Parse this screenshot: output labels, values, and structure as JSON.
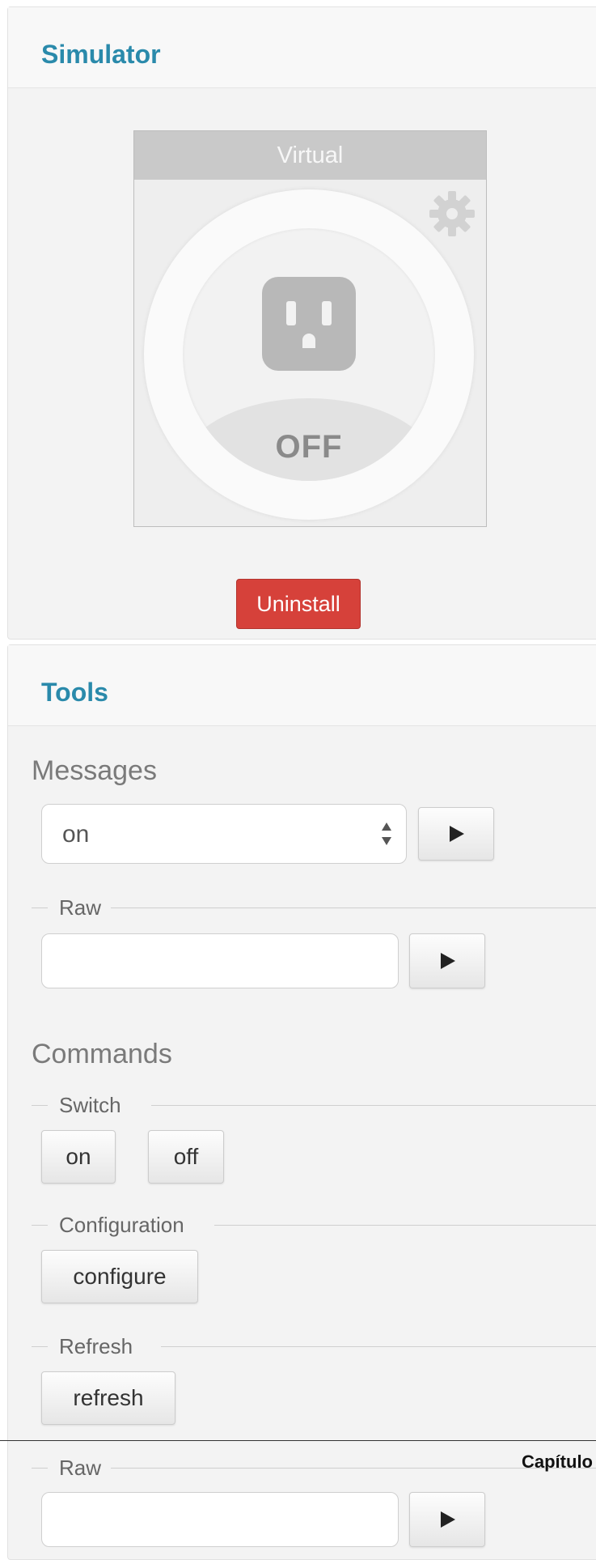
{
  "simulator": {
    "title": "Simulator",
    "device": {
      "name": "Virtual",
      "state": "OFF",
      "icons": [
        "gear-icon",
        "outlet-icon"
      ]
    },
    "uninstall_label": "Uninstall",
    "colors": {
      "title": "#2a8aab",
      "danger": "#d6413a"
    }
  },
  "tools": {
    "title": "Tools",
    "messages": {
      "heading": "Messages",
      "selected": "on",
      "raw_label": "Raw",
      "raw_value": ""
    },
    "commands": {
      "heading": "Commands",
      "switch_label": "Switch",
      "switch_buttons": [
        "on",
        "off"
      ],
      "configuration_label": "Configuration",
      "configure_button": "configure",
      "refresh_label": "Refresh",
      "refresh_button": "refresh",
      "raw_label": "Raw",
      "raw_value": ""
    }
  },
  "overlay": {
    "chapter_text": "Capítulo"
  }
}
